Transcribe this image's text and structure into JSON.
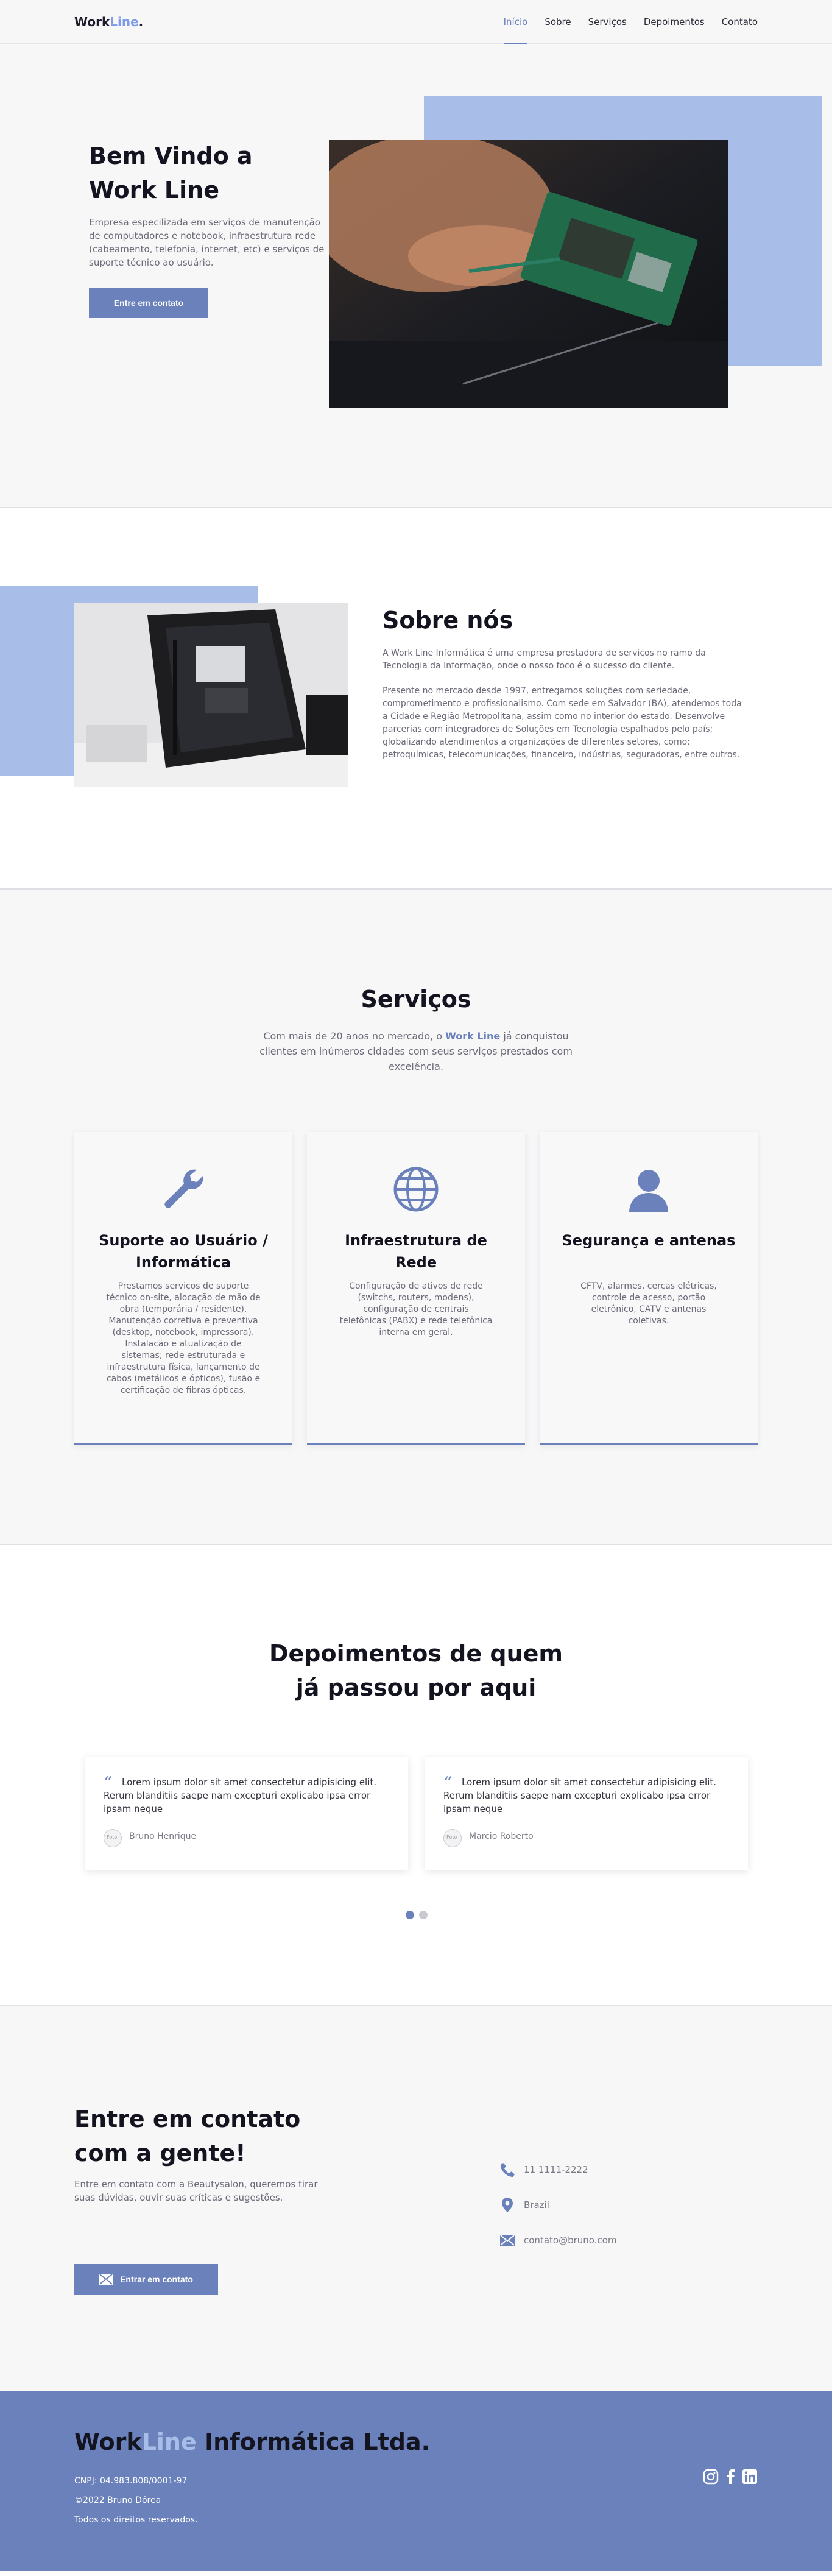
{
  "header": {
    "logo_main": "Work",
    "logo_accent": "Line",
    "logo_dot": ".",
    "nav": [
      "Início",
      "Sobre",
      "Serviços",
      "Depoimentos",
      "Contato"
    ]
  },
  "hero": {
    "title": "Bem Vindo a Work Line",
    "text": "Empresa especilizada em serviços de manutenção de computadores e notebook, infraestrutura rede (cabeamento, telefonia, internet, etc) e serviços de suporte técnico ao usuário.",
    "button": "Entre em contato"
  },
  "about": {
    "title": "Sobre nós",
    "p1": "A Work Line Informática é uma empresa prestadora de serviços no ramo da Tecnologia da Informação, onde o nosso foco é o sucesso do cliente.",
    "p2": "Presente no mercado desde 1997, entregamos soluções com seriedade, comprometimento e profissionalismo. Com sede em Salvador (BA), atendemos toda a Cidade e Região Metropolitana, assim como no interior do estado. Desenvolve parcerias com integradores de Soluções em Tecnologia espalhados pelo país; globalizando atendimentos a organizações de diferentes setores, como: petroquímicas, telecomunicações, financeiro, indústrias, seguradoras, entre outros."
  },
  "services": {
    "title": "Serviços",
    "intro_before": "Com mais de 20 anos no mercado, o ",
    "intro_highlight": "Work Line",
    "intro_after": " já conquistou clientes em inúmeros cidades com seus serviços prestados com excelência.",
    "cards": [
      {
        "icon": "wrench-icon",
        "title": "Suporte ao Usuário / Informática",
        "text": "Prestamos serviços de suporte técnico on-site, alocação de mão de obra (temporária / residente). Manutenção corretiva e preventiva (desktop, notebook, impressora). Instalação e atualização de sistemas; rede estruturada e infraestrutura física, lançamento de cabos (metálicos e ópticos), fusão e certificação de fibras ópticas."
      },
      {
        "icon": "globe-icon",
        "title": "Infraestrutura de Rede",
        "text": "Configuração de ativos de rede (switchs, routers, modens), configuração de centrais telefônicas (PABX) e rede telefônica interna em geral."
      },
      {
        "icon": "user-icon",
        "title": "Segurança e antenas",
        "text": "CFTV, alarmes, cercas elétricas, controle de acesso, portão eletrônico, CATV e antenas coletivas."
      }
    ]
  },
  "testimonials": {
    "title": "Depoimentos de quem já passou por aqui",
    "items": [
      {
        "text": "Lorem ipsum dolor sit amet consectetur adipisicing elit. Rerum blanditiis saepe nam excepturi explicabo ipsa error ipsam neque",
        "avatar_alt": "Foto",
        "name": "Bruno Henrique"
      },
      {
        "text": "Lorem ipsum dolor sit amet consectetur adipisicing elit. Rerum blanditiis saepe nam excepturi explicabo ipsa error ipsam neque",
        "avatar_alt": "Foto",
        "name": "Marcio Roberto"
      }
    ]
  },
  "contact": {
    "title": "Entre em contato com a gente!",
    "text": "Entre em contato com a Beautysalon, queremos tirar suas dúvidas, ouvir suas críticas e sugestões.",
    "button": "Entrar em contato",
    "phone": "11 1111-2222",
    "location": "Brazil",
    "email": "contato@bruno.com"
  },
  "footer": {
    "title_main": "Work",
    "title_accent": "Line",
    "title_rest": " Informática Ltda.",
    "cnpj": "CNPJ: 04.983.808/0001-97",
    "copyright": "©2022 Bruno Dórea",
    "rights": "Todos os direitos reservados."
  },
  "colors": {
    "accent": "#6b81bb",
    "accent_light": "#a9bde9",
    "background_light": "#f7f7f8"
  }
}
